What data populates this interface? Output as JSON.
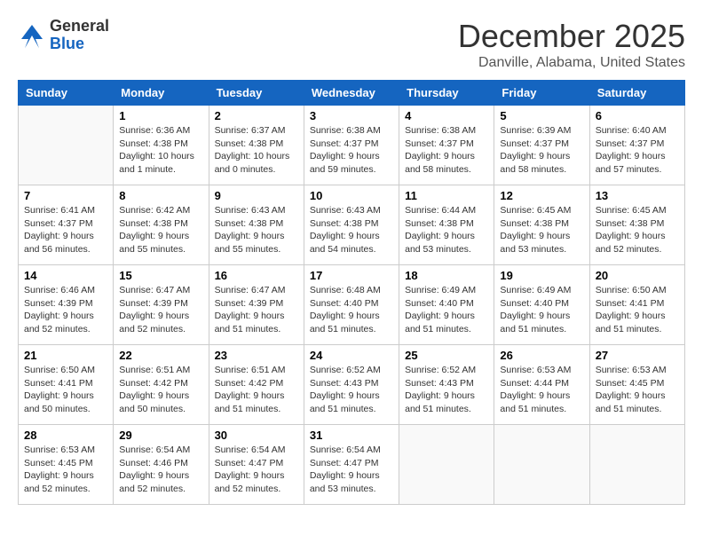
{
  "header": {
    "logo_general": "General",
    "logo_blue": "Blue",
    "month_title": "December 2025",
    "location": "Danville, Alabama, United States"
  },
  "days_of_week": [
    "Sunday",
    "Monday",
    "Tuesday",
    "Wednesday",
    "Thursday",
    "Friday",
    "Saturday"
  ],
  "weeks": [
    [
      {
        "day": "",
        "info": ""
      },
      {
        "day": "1",
        "info": "Sunrise: 6:36 AM\nSunset: 4:38 PM\nDaylight: 10 hours\nand 1 minute."
      },
      {
        "day": "2",
        "info": "Sunrise: 6:37 AM\nSunset: 4:38 PM\nDaylight: 10 hours\nand 0 minutes."
      },
      {
        "day": "3",
        "info": "Sunrise: 6:38 AM\nSunset: 4:37 PM\nDaylight: 9 hours\nand 59 minutes."
      },
      {
        "day": "4",
        "info": "Sunrise: 6:38 AM\nSunset: 4:37 PM\nDaylight: 9 hours\nand 58 minutes."
      },
      {
        "day": "5",
        "info": "Sunrise: 6:39 AM\nSunset: 4:37 PM\nDaylight: 9 hours\nand 58 minutes."
      },
      {
        "day": "6",
        "info": "Sunrise: 6:40 AM\nSunset: 4:37 PM\nDaylight: 9 hours\nand 57 minutes."
      }
    ],
    [
      {
        "day": "7",
        "info": "Sunrise: 6:41 AM\nSunset: 4:37 PM\nDaylight: 9 hours\nand 56 minutes."
      },
      {
        "day": "8",
        "info": "Sunrise: 6:42 AM\nSunset: 4:38 PM\nDaylight: 9 hours\nand 55 minutes."
      },
      {
        "day": "9",
        "info": "Sunrise: 6:43 AM\nSunset: 4:38 PM\nDaylight: 9 hours\nand 55 minutes."
      },
      {
        "day": "10",
        "info": "Sunrise: 6:43 AM\nSunset: 4:38 PM\nDaylight: 9 hours\nand 54 minutes."
      },
      {
        "day": "11",
        "info": "Sunrise: 6:44 AM\nSunset: 4:38 PM\nDaylight: 9 hours\nand 53 minutes."
      },
      {
        "day": "12",
        "info": "Sunrise: 6:45 AM\nSunset: 4:38 PM\nDaylight: 9 hours\nand 53 minutes."
      },
      {
        "day": "13",
        "info": "Sunrise: 6:45 AM\nSunset: 4:38 PM\nDaylight: 9 hours\nand 52 minutes."
      }
    ],
    [
      {
        "day": "14",
        "info": "Sunrise: 6:46 AM\nSunset: 4:39 PM\nDaylight: 9 hours\nand 52 minutes."
      },
      {
        "day": "15",
        "info": "Sunrise: 6:47 AM\nSunset: 4:39 PM\nDaylight: 9 hours\nand 52 minutes."
      },
      {
        "day": "16",
        "info": "Sunrise: 6:47 AM\nSunset: 4:39 PM\nDaylight: 9 hours\nand 51 minutes."
      },
      {
        "day": "17",
        "info": "Sunrise: 6:48 AM\nSunset: 4:40 PM\nDaylight: 9 hours\nand 51 minutes."
      },
      {
        "day": "18",
        "info": "Sunrise: 6:49 AM\nSunset: 4:40 PM\nDaylight: 9 hours\nand 51 minutes."
      },
      {
        "day": "19",
        "info": "Sunrise: 6:49 AM\nSunset: 4:40 PM\nDaylight: 9 hours\nand 51 minutes."
      },
      {
        "day": "20",
        "info": "Sunrise: 6:50 AM\nSunset: 4:41 PM\nDaylight: 9 hours\nand 51 minutes."
      }
    ],
    [
      {
        "day": "21",
        "info": "Sunrise: 6:50 AM\nSunset: 4:41 PM\nDaylight: 9 hours\nand 50 minutes."
      },
      {
        "day": "22",
        "info": "Sunrise: 6:51 AM\nSunset: 4:42 PM\nDaylight: 9 hours\nand 50 minutes."
      },
      {
        "day": "23",
        "info": "Sunrise: 6:51 AM\nSunset: 4:42 PM\nDaylight: 9 hours\nand 51 minutes."
      },
      {
        "day": "24",
        "info": "Sunrise: 6:52 AM\nSunset: 4:43 PM\nDaylight: 9 hours\nand 51 minutes."
      },
      {
        "day": "25",
        "info": "Sunrise: 6:52 AM\nSunset: 4:43 PM\nDaylight: 9 hours\nand 51 minutes."
      },
      {
        "day": "26",
        "info": "Sunrise: 6:53 AM\nSunset: 4:44 PM\nDaylight: 9 hours\nand 51 minutes."
      },
      {
        "day": "27",
        "info": "Sunrise: 6:53 AM\nSunset: 4:45 PM\nDaylight: 9 hours\nand 51 minutes."
      }
    ],
    [
      {
        "day": "28",
        "info": "Sunrise: 6:53 AM\nSunset: 4:45 PM\nDaylight: 9 hours\nand 52 minutes."
      },
      {
        "day": "29",
        "info": "Sunrise: 6:54 AM\nSunset: 4:46 PM\nDaylight: 9 hours\nand 52 minutes."
      },
      {
        "day": "30",
        "info": "Sunrise: 6:54 AM\nSunset: 4:47 PM\nDaylight: 9 hours\nand 52 minutes."
      },
      {
        "day": "31",
        "info": "Sunrise: 6:54 AM\nSunset: 4:47 PM\nDaylight: 9 hours\nand 53 minutes."
      },
      {
        "day": "",
        "info": ""
      },
      {
        "day": "",
        "info": ""
      },
      {
        "day": "",
        "info": ""
      }
    ]
  ]
}
